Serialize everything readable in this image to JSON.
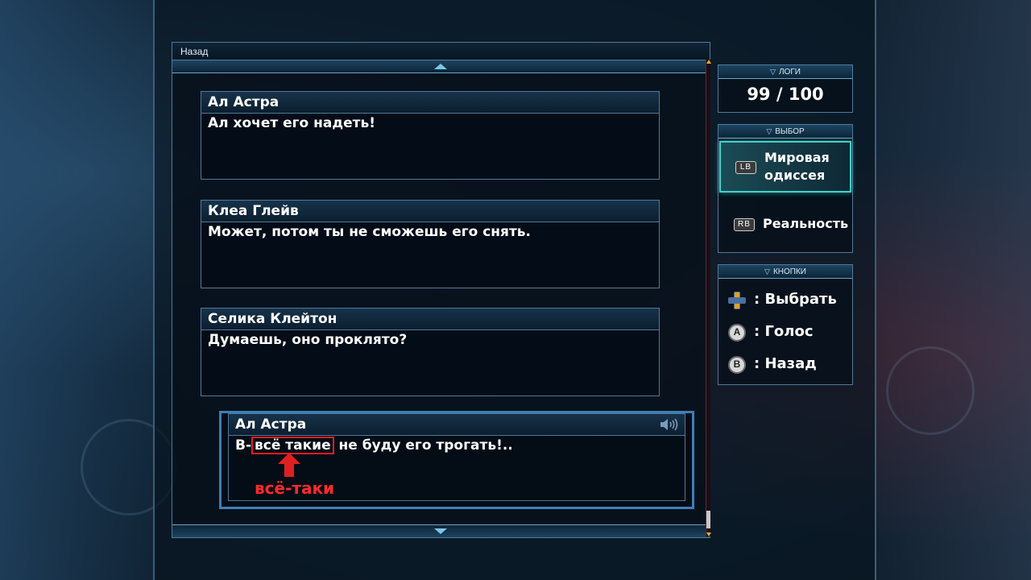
{
  "header": {
    "back_label": "Назад"
  },
  "log_entries": [
    {
      "speaker": "Ал Астра",
      "text": "Ал хочет его надеть!"
    },
    {
      "speaker": "Клеа Глейв",
      "text": "Может, потом ты не сможешь его снять."
    },
    {
      "speaker": "Селика Клейтон",
      "text": "Думаешь, оно проклято?"
    }
  ],
  "current_entry": {
    "speaker": "Ал Астра",
    "text_prefix": "В-",
    "text_highlight": "всё такие",
    "text_suffix": " не буду его трогать!..",
    "correction": "всё-таки"
  },
  "logs_panel": {
    "title": "ЛОГИ",
    "count": "99 / 100"
  },
  "choice_panel": {
    "title": "ВЫБОР",
    "items": [
      {
        "button": "LB",
        "label_line1": "Мировая",
        "label_line2": "одиссея",
        "selected": true
      },
      {
        "button": "RB",
        "label": "Реальность",
        "selected": false
      }
    ]
  },
  "buttons_panel": {
    "title": "КНОПКИ",
    "hints": [
      {
        "icon": "dpad-icon",
        "label": ": Выбрать"
      },
      {
        "icon": "a-button-icon",
        "glyph": "A",
        "label": ": Голос"
      },
      {
        "icon": "b-button-icon",
        "glyph": "B",
        "label": ": Назад"
      }
    ]
  },
  "colors": {
    "accent_cyan": "#44d0c8",
    "frame_blue": "#4e7a9a",
    "highlight_red": "#e02020"
  }
}
